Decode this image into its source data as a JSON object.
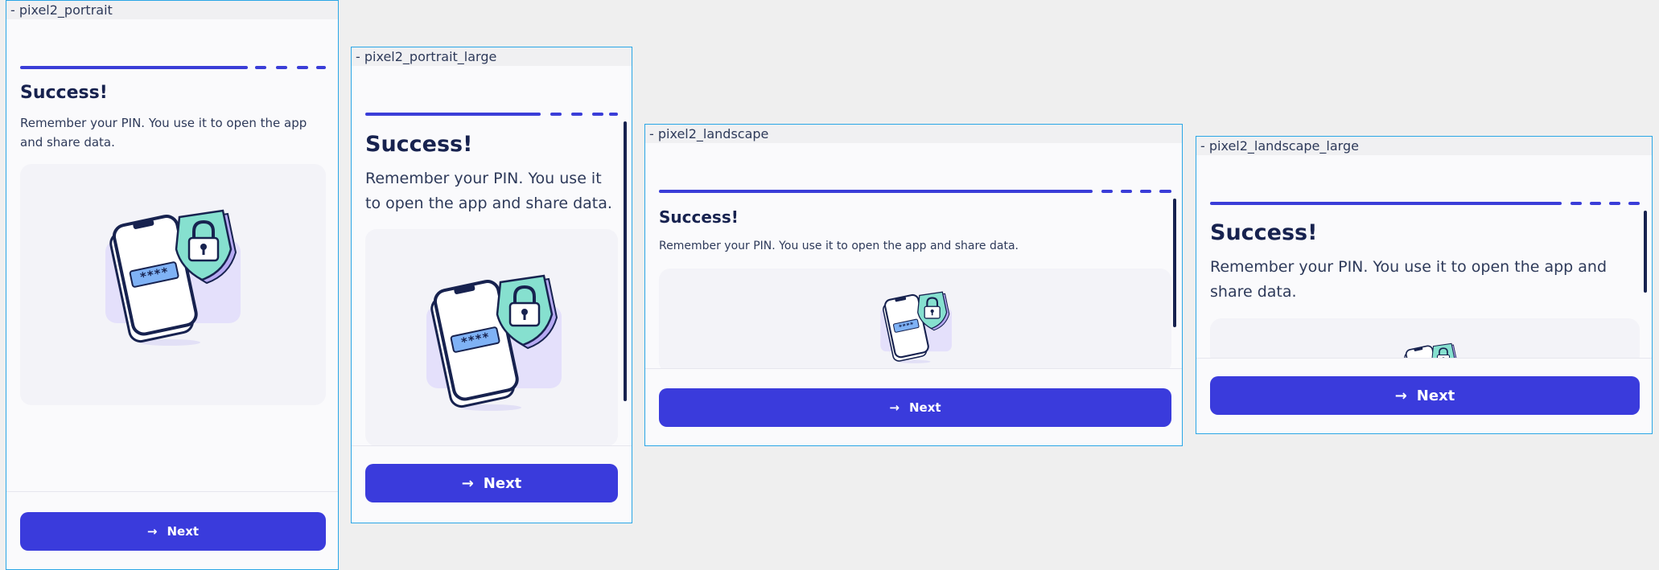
{
  "colors": {
    "accent": "#3a3bdc",
    "title": "#17224f",
    "frame_border": "#2aa6e6"
  },
  "screen": {
    "title": "Success!",
    "message": "Remember your PIN. You use it to open the app and share data.",
    "next_label": "Next",
    "next_icon": "arrow-right-icon",
    "pin_mask": "****"
  },
  "frames": [
    {
      "label": "- pixel2_portrait"
    },
    {
      "label": "- pixel2_portrait_large"
    },
    {
      "label": "- pixel2_landscape"
    },
    {
      "label": "- pixel2_landscape_large"
    }
  ]
}
